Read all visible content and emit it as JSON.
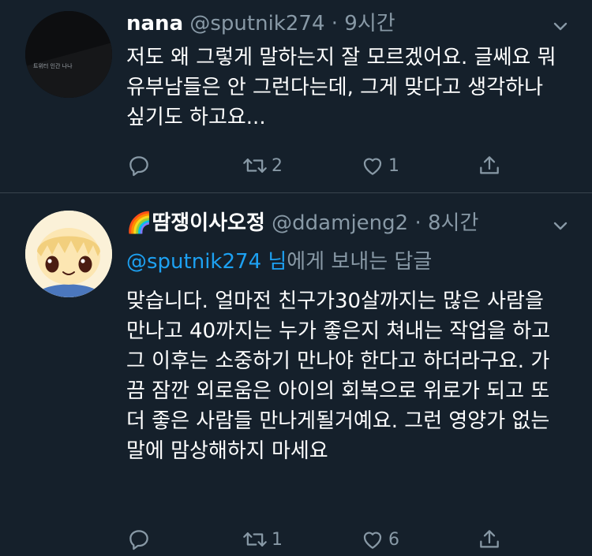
{
  "tweets": [
    {
      "name": "nana",
      "handle": "@sputnik274",
      "time": "9시간",
      "avatar_text": "트위터 인간 나나",
      "text": "저도 왜 그렇게 말하는지 잘 모르겠어요. 글쎄요 뭐 유부남들은 안 그런다는데, 그게 맞다고 생각하나 싶기도 하고요...",
      "reply_count": "",
      "retweet_count": "2",
      "like_count": "1"
    },
    {
      "name": "🌈땀쟁이사오정",
      "handle": "@ddamjeng2",
      "time": "8시간",
      "reply_to_handle": "@sputnik274",
      "reply_to_suffix_accent": " 님",
      "reply_to_suffix": "에게 보내는 답글",
      "text": "맞습니다. 얼마전 친구가30살까지는 많은 사람을 만나고 40까지는 누가 좋은지 쳐내는 작업을 하고 그 이후는 소중하기 만나야 한다고 하더라구요. 가끔 잠깐 외로움은 아이의 회복으로 위로가 되고 또 더 좋은 사람들 만나게될거예요. 그런 영양가 없는 말에 맘상해하지 마세요",
      "reply_count": "",
      "retweet_count": "1",
      "like_count": "6"
    }
  ],
  "colors": {
    "background": "#15202b",
    "secondary_text": "#8899a6",
    "link": "#1da1f2",
    "divider": "#38444d"
  }
}
